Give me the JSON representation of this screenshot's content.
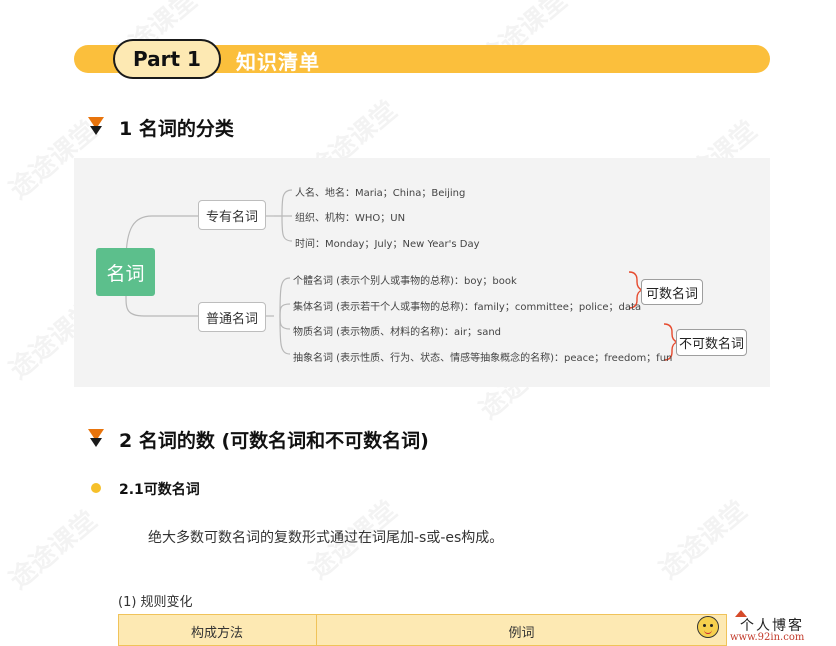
{
  "header": {
    "part_label": "Part 1",
    "title": "知识清单"
  },
  "section1": {
    "heading": "1 名词的分类"
  },
  "mindmap": {
    "root": "名词",
    "proper": {
      "label": "专有名词",
      "items": [
        "人名、地名：Maria；China；Beijing",
        "组织、机构：WHO；UN",
        "时间：Monday；July；New Year's Day"
      ]
    },
    "common": {
      "label": "普通名词",
      "items": [
        "个體名词 (表示个别人或事物的总称)：boy；book",
        "集体名词 (表示若干个人或事物的总称)：family；committee；police；data",
        "物质名词 (表示物质、材料的名称)：air；sand",
        "抽象名词 (表示性质、行为、状态、情感等抽象概念的名称)：peace；freedom；fun"
      ]
    },
    "countable_tag": "可数名词",
    "uncountable_tag": "不可数名词"
  },
  "section2": {
    "heading": "2 名词的数 (可数名词和不可数名词)",
    "sub_heading": "2.1可数名词",
    "paragraph": "绝大多数可数名词的复数形式通过在词尾加-s或-es构成。",
    "rule_label": "(1) 规则变化",
    "table_headers": [
      "构成方法",
      "例词"
    ]
  },
  "watermark": "途途课堂",
  "footer": {
    "logo_cn": "个人博客",
    "logo_url": "www.92in.com"
  },
  "colors": {
    "banner": "#fbbf3c",
    "pill": "#fde9b3",
    "triangle": "#e8740c",
    "root_node": "#5cbf8c",
    "bullet": "#f6c02a",
    "bracket": "#e64a2e"
  }
}
